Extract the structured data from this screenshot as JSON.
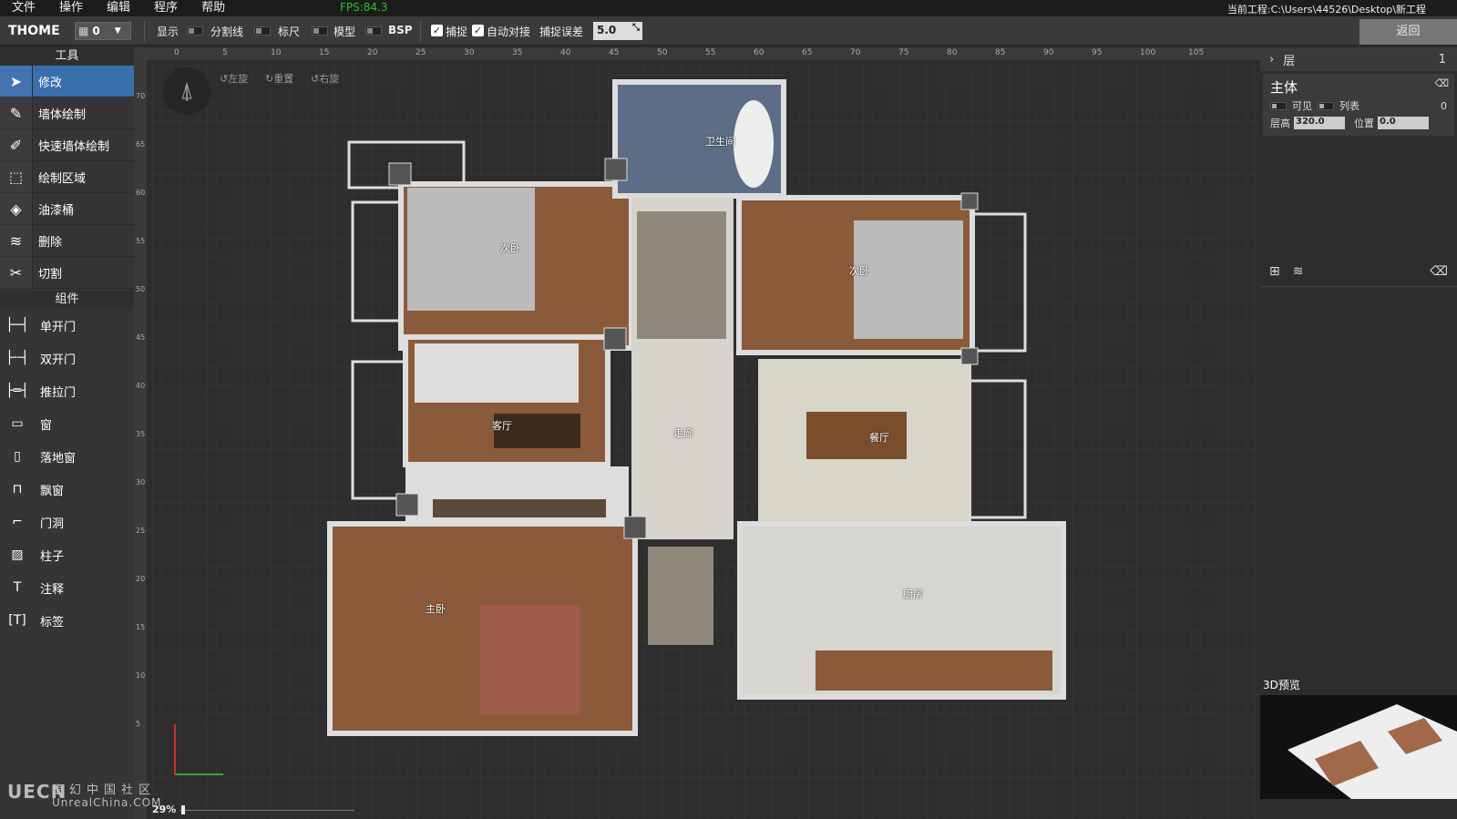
{
  "menu": [
    "文件",
    "操作",
    "编辑",
    "程序",
    "帮助"
  ],
  "fps": "FPS:84.3",
  "project_path": "当前工程:C:\\Users\\44526\\Desktop\\新工程",
  "toolbar": {
    "brand": "THOME",
    "layer_value": "0",
    "display_label": "显示",
    "divider_label": "分割线",
    "ruler_label": "标尺",
    "model_label": "模型",
    "bsp_label": "BSP",
    "snap_label": "捕捉",
    "auto_align_label": "自动对接",
    "snap_error_label": "捕捉误差",
    "snap_error_value": "5.0",
    "back_label": "返回"
  },
  "tools_header": "工具",
  "tools": [
    {
      "label": "修改",
      "icon": "cursor-icon"
    },
    {
      "label": "墙体绘制",
      "icon": "pen-icon"
    },
    {
      "label": "快速墙体绘制",
      "icon": "quick-pen-icon"
    },
    {
      "label": "绘制区域",
      "icon": "area-icon"
    },
    {
      "label": "油漆桶",
      "icon": "paint-bucket-icon"
    },
    {
      "label": "删除",
      "icon": "delete-icon"
    },
    {
      "label": "切割",
      "icon": "cut-icon"
    }
  ],
  "components_header": "组件",
  "components": [
    {
      "label": "单开门",
      "icon": "single-door-icon"
    },
    {
      "label": "双开门",
      "icon": "double-door-icon"
    },
    {
      "label": "推拉门",
      "icon": "sliding-door-icon"
    },
    {
      "label": "窗",
      "icon": "window-icon"
    },
    {
      "label": "落地窗",
      "icon": "floor-window-icon"
    },
    {
      "label": "飘窗",
      "icon": "bay-window-icon"
    },
    {
      "label": "门洞",
      "icon": "doorway-icon"
    },
    {
      "label": "柱子",
      "icon": "column-icon"
    },
    {
      "label": "注释",
      "icon": "annotation-icon"
    },
    {
      "label": "标签",
      "icon": "tag-icon"
    }
  ],
  "viewport": {
    "rotate_left": "左旋",
    "reset": "重置",
    "rotate_right": "右旋",
    "ruler_top": [
      "0",
      "5",
      "10",
      "15",
      "20",
      "25",
      "30",
      "35",
      "40",
      "45",
      "50",
      "55",
      "60",
      "65",
      "70",
      "75",
      "80",
      "85",
      "90",
      "95",
      "100",
      "105"
    ],
    "ruler_left": [
      "70",
      "65",
      "60",
      "55",
      "50",
      "45",
      "40",
      "35",
      "30",
      "25",
      "20",
      "15",
      "10",
      "5"
    ],
    "rooms": {
      "bathroom": "卫生间",
      "bedroom2a": "次卧",
      "bedroom2b": "次卧",
      "living": "客厅",
      "corridor": "走廊",
      "dining": "餐厅",
      "master": "主卧",
      "kitchen": "厨房"
    },
    "zoom": "29%"
  },
  "right_panel": {
    "header": "层",
    "count": "1",
    "layer_name": "主体",
    "visible_label": "可见",
    "list_label": "列表",
    "list_value": "0",
    "height_label": "层高",
    "height_value": "320.0",
    "position_label": "位置",
    "position_value": "0.0",
    "preview_label": "3D预览"
  },
  "watermark": {
    "logo": "UECN",
    "title": "虚幻中国社区",
    "domain": "UnrealChina.COM"
  }
}
